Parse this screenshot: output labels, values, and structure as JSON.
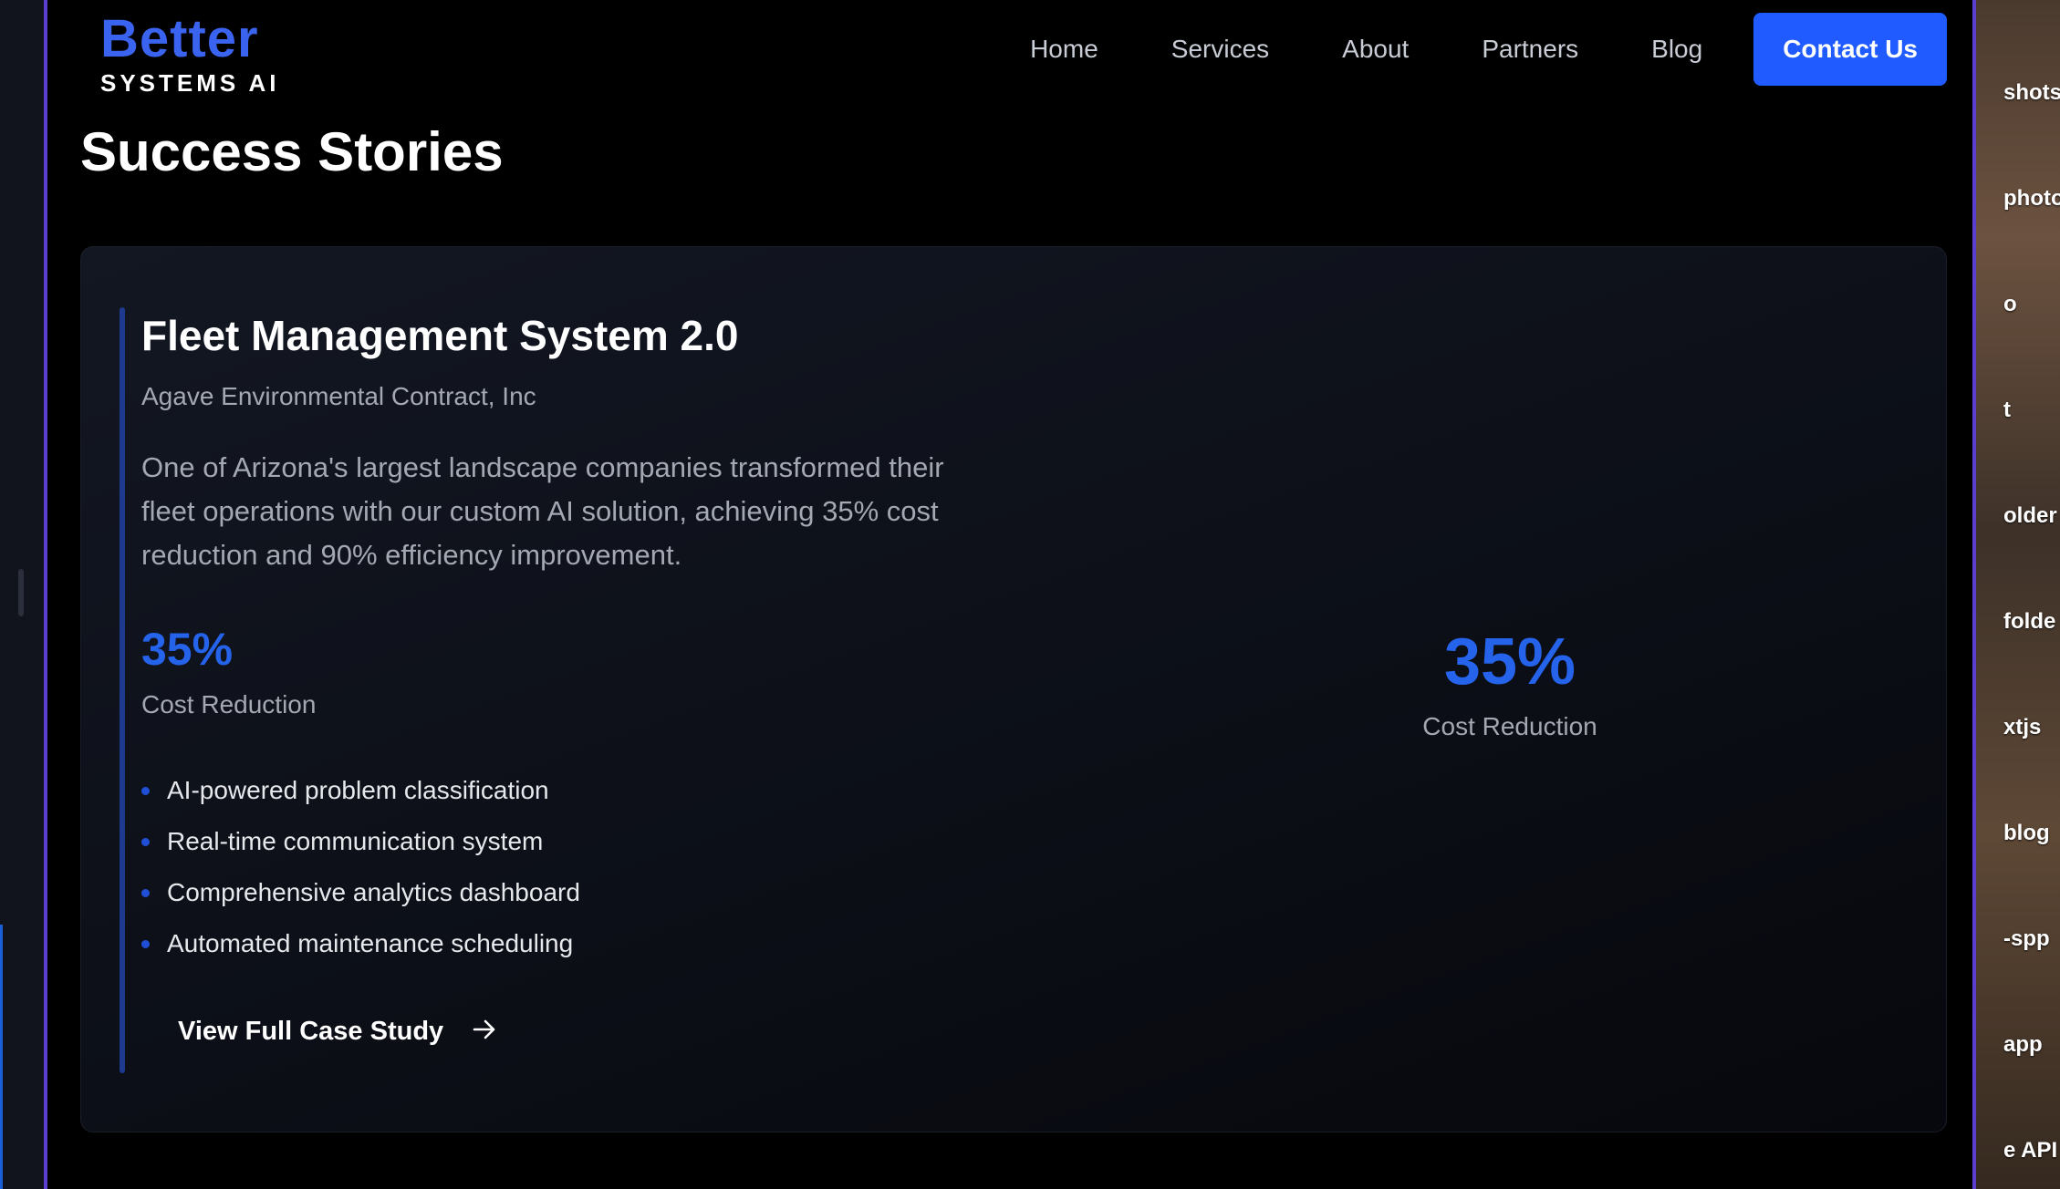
{
  "header": {
    "logo_top": "Better",
    "logo_bottom": "SYSTEMS AI",
    "nav": [
      "Home",
      "Services",
      "About",
      "Partners",
      "Blog"
    ],
    "contact_label": "Contact Us"
  },
  "page": {
    "title": "Success Stories"
  },
  "case_study": {
    "title": "Fleet Management System 2.0",
    "company": "Agave Environmental Contract, Inc",
    "description": "One of Arizona's largest landscape companies transformed their fleet operations with our custom AI solution, achieving 35% cost reduction and 90% efficiency improvement.",
    "stat_value": "35%",
    "stat_label": "Cost Reduction",
    "features": [
      "AI-powered problem classification",
      "Real-time communication system",
      "Comprehensive analytics dashboard",
      "Automated maintenance scheduling"
    ],
    "link_label": "View Full Case Study",
    "highlight_value": "35%",
    "highlight_label": "Cost Reduction"
  },
  "desktop": {
    "labels": [
      "shots",
      "photo",
      "o",
      "t",
      "older",
      "folde",
      "xtjs",
      "blog",
      "-spp",
      "app",
      "e API"
    ]
  },
  "colors": {
    "accent": "#2563eb",
    "button": "#1f5bff",
    "window_border": "#5a3fd1"
  }
}
